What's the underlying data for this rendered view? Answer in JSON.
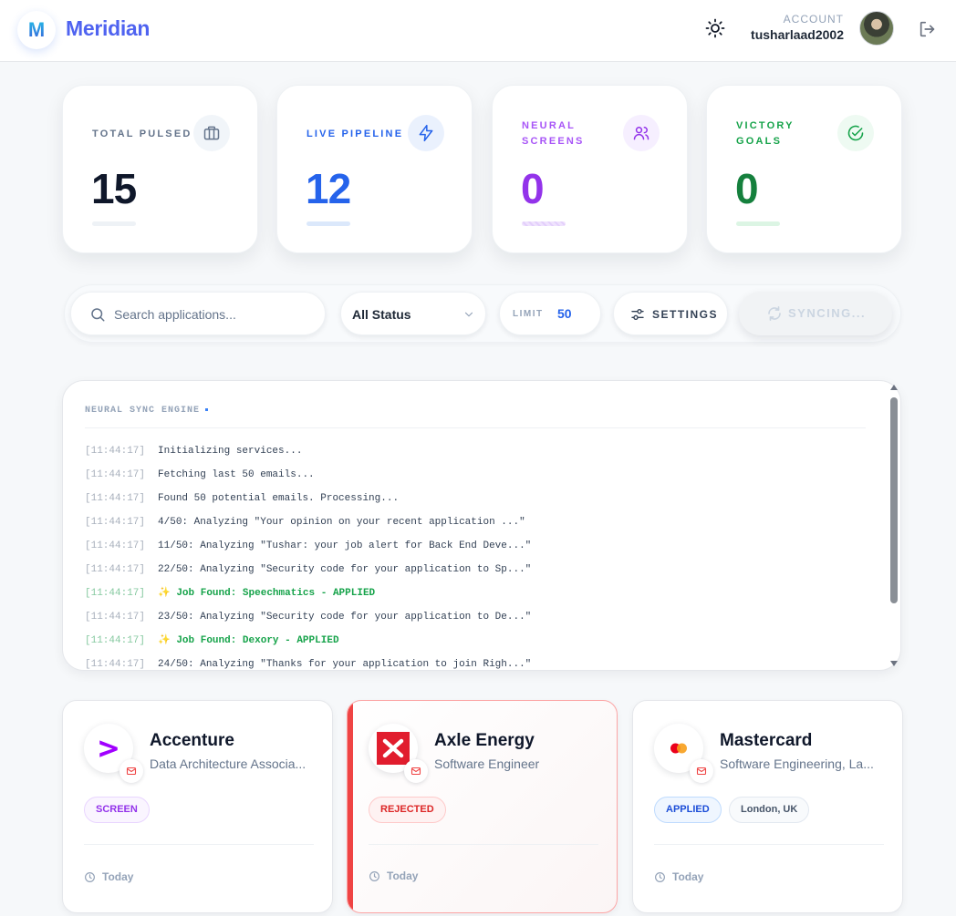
{
  "header": {
    "logo_letter": "M",
    "brand": "Meridian",
    "account_label": "ACCOUNT",
    "username": "tusharlaad2002",
    "icons": [
      "sun-icon",
      "logout-icon"
    ]
  },
  "stats": [
    {
      "label": "TOTAL PULSED",
      "value": "15",
      "color": "#0f172a",
      "icon": "briefcase-icon"
    },
    {
      "label": "LIVE PIPELINE",
      "value": "12",
      "color": "#2563eb",
      "icon": "lightning-icon"
    },
    {
      "label": "NEURAL SCREENS",
      "value": "0",
      "color": "#9333ea",
      "icon": "users-icon"
    },
    {
      "label": "VICTORY GOALS",
      "value": "0",
      "color": "#16a34a",
      "icon": "check-circle-icon"
    }
  ],
  "toolbar": {
    "search_placeholder": "Search applications...",
    "status_value": "All Status",
    "limit_label": "LIMIT",
    "limit_value": "50",
    "settings_label": "SETTINGS",
    "sync_label": "SYNCING..."
  },
  "log": {
    "title": "NEURAL SYNC ENGINE",
    "lines": [
      {
        "ts": "[11:44:17]",
        "msg": "Initializing services...",
        "found": false
      },
      {
        "ts": "[11:44:17]",
        "msg": "Fetching last 50 emails...",
        "found": false
      },
      {
        "ts": "[11:44:17]",
        "msg": "Found 50 potential emails. Processing...",
        "found": false
      },
      {
        "ts": "[11:44:17]",
        "msg": "4/50: Analyzing \"Your opinion on your recent application ...\"",
        "found": false
      },
      {
        "ts": "[11:44:17]",
        "msg": "11/50: Analyzing \"Tushar: your job alert for Back End Deve...\"",
        "found": false
      },
      {
        "ts": "[11:44:17]",
        "msg": "22/50: Analyzing \"Security code for your application to Sp...\"",
        "found": false
      },
      {
        "ts": "[11:44:17]",
        "msg": "✨ Job Found: Speechmatics - APPLIED",
        "found": true
      },
      {
        "ts": "[11:44:17]",
        "msg": "23/50: Analyzing \"Security code for your application to De...\"",
        "found": false
      },
      {
        "ts": "[11:44:17]",
        "msg": "✨ Job Found: Dexory - APPLIED",
        "found": true
      },
      {
        "ts": "[11:44:17]",
        "msg": "24/50: Analyzing \"Thanks for your application to join Righ...\"",
        "found": false
      }
    ]
  },
  "jobs": [
    {
      "company": "Accenture",
      "role": "Data Architecture Associa...",
      "status": "SCREEN",
      "location": "",
      "date": "Today",
      "logo": "accenture-logo-icon"
    },
    {
      "company": "Axle Energy",
      "role": "Software Engineer",
      "status": "REJECTED",
      "location": "",
      "date": "Today",
      "logo": "axle-logo-icon"
    },
    {
      "company": "Mastercard",
      "role": "Software Engineering, La...",
      "status": "APPLIED",
      "location": "London, UK",
      "date": "Today",
      "logo": "mastercard-logo-icon"
    }
  ],
  "colors": {
    "brand": "#4f63f0",
    "screen": "#9333ea",
    "rejected": "#dc2626",
    "applied": "#1d4ed8",
    "success": "#16a34a"
  }
}
